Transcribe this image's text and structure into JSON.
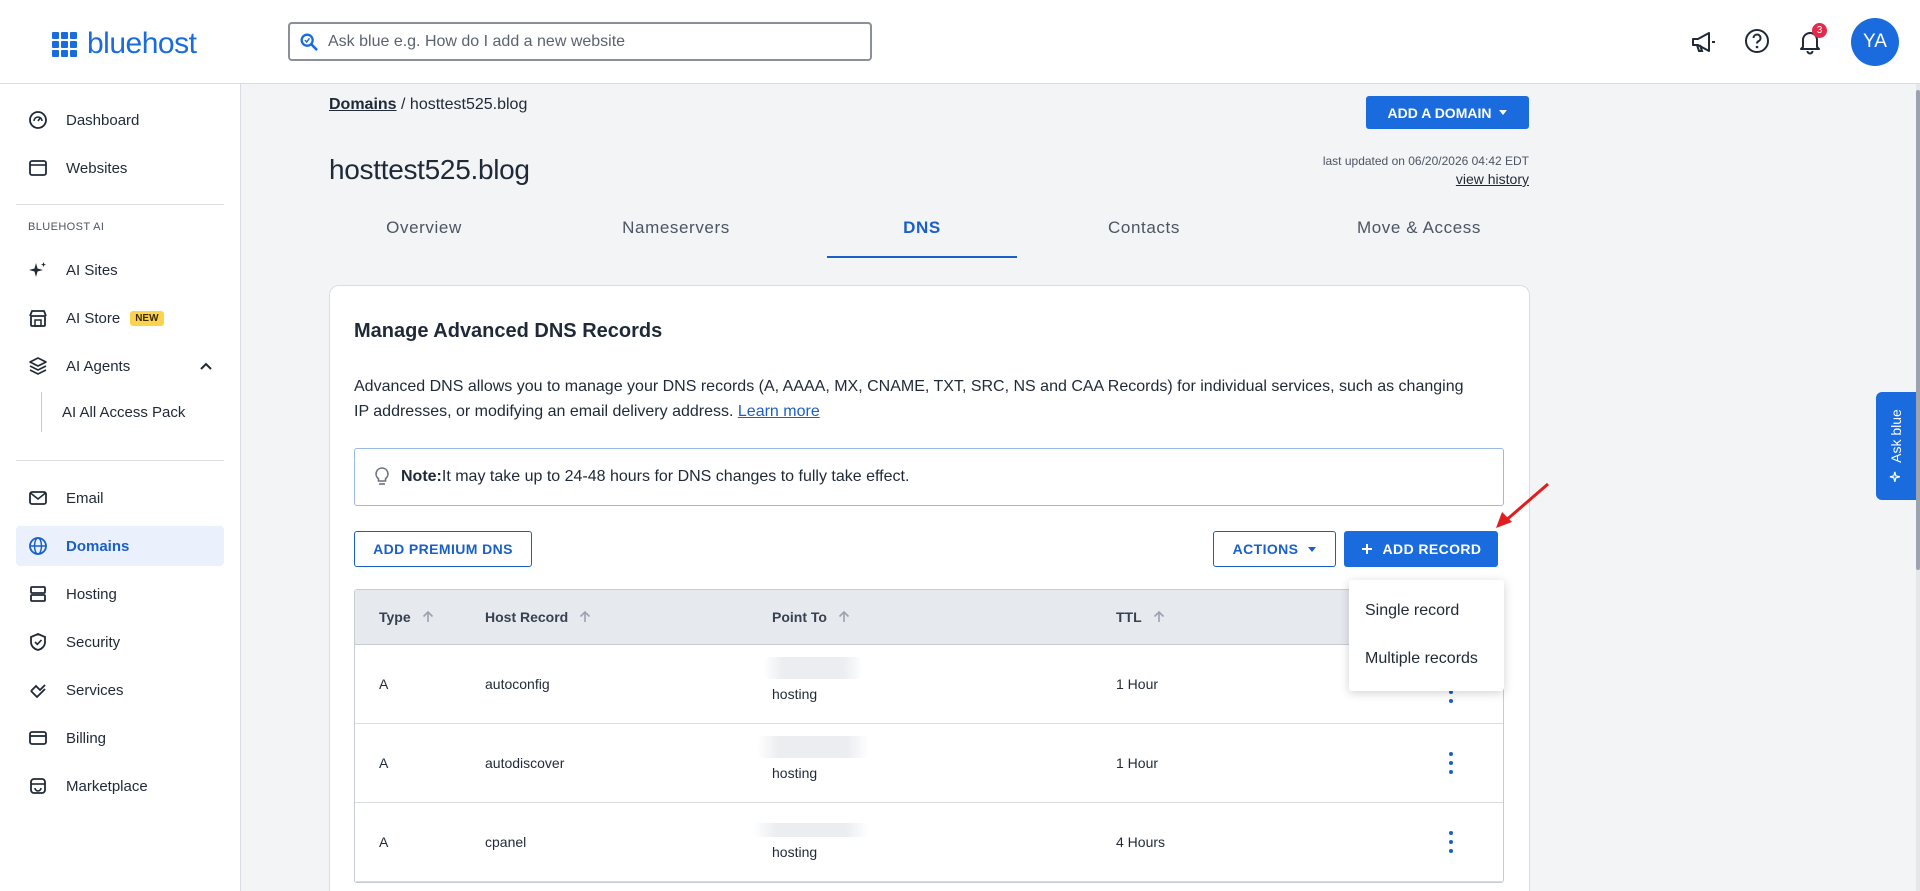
{
  "brand": {
    "name": "bluehost",
    "color": "#196bde"
  },
  "search": {
    "placeholder": "Ask blue e.g. How do I add a new website"
  },
  "topbar": {
    "notifications_count": "3",
    "avatar_initials": "YA"
  },
  "sidebar": {
    "items": [
      {
        "label": "Dashboard",
        "icon": "dashboard-icon"
      },
      {
        "label": "Websites",
        "icon": "websites-icon"
      }
    ],
    "ai_section_label": "BLUEHOST AI",
    "ai_items": [
      {
        "label": "AI Sites",
        "icon": "sparkle-icon"
      },
      {
        "label": "AI Store",
        "icon": "store-icon",
        "badge": "NEW"
      },
      {
        "label": "AI Agents",
        "icon": "layers-icon"
      }
    ],
    "ai_sub_items": [
      {
        "label": "AI All Access Pack"
      }
    ],
    "main_items": [
      {
        "label": "Email",
        "icon": "mail-icon"
      },
      {
        "label": "Domains",
        "icon": "globe-icon",
        "active": true
      },
      {
        "label": "Hosting",
        "icon": "server-icon"
      },
      {
        "label": "Security",
        "icon": "shield-icon"
      },
      {
        "label": "Services",
        "icon": "services-icon"
      },
      {
        "label": "Billing",
        "icon": "card-icon"
      },
      {
        "label": "Marketplace",
        "icon": "marketplace-icon"
      }
    ]
  },
  "breadcrumb": {
    "root": "Domains",
    "separator": " / ",
    "current": "hosttest525.blog"
  },
  "page": {
    "title": "hosttest525.blog",
    "add_domain_label": "ADD A DOMAIN",
    "last_updated": "last updated on 06/20/2026 04:42 EDT",
    "view_history": "view history"
  },
  "tabs": [
    {
      "label": "Overview"
    },
    {
      "label": "Nameservers"
    },
    {
      "label": "DNS",
      "active": true
    },
    {
      "label": "Contacts"
    },
    {
      "label": "Move & Access"
    }
  ],
  "dns_card": {
    "title": "Manage Advanced DNS Records",
    "description": "Advanced DNS allows you to manage your DNS records (A, AAAA, MX, CNAME, TXT, SRC, NS and CAA Records) for individual services, such as changing IP addresses, or modifying an email delivery address. ",
    "learn_more": "Learn more",
    "note_label": "Note:",
    "note_text": " It may take up to 24-48 hours for DNS changes to fully take effect.",
    "add_premium_dns": "ADD PREMIUM DNS",
    "actions_label": "ACTIONS",
    "add_record_label": "ADD RECORD"
  },
  "table": {
    "columns": [
      "Type",
      "Host Record",
      "Point To",
      "TTL"
    ],
    "rows": [
      {
        "type": "A",
        "host": "autoconfig",
        "point_to": "hosting",
        "ttl": "1 Hour"
      },
      {
        "type": "A",
        "host": "autodiscover",
        "point_to": "hosting",
        "ttl": "1 Hour"
      },
      {
        "type": "A",
        "host": "cpanel",
        "point_to": "hosting",
        "ttl": "4 Hours"
      }
    ]
  },
  "add_record_menu": [
    "Single record",
    "Multiple records"
  ],
  "ask_blue": {
    "label": "Ask blue"
  }
}
